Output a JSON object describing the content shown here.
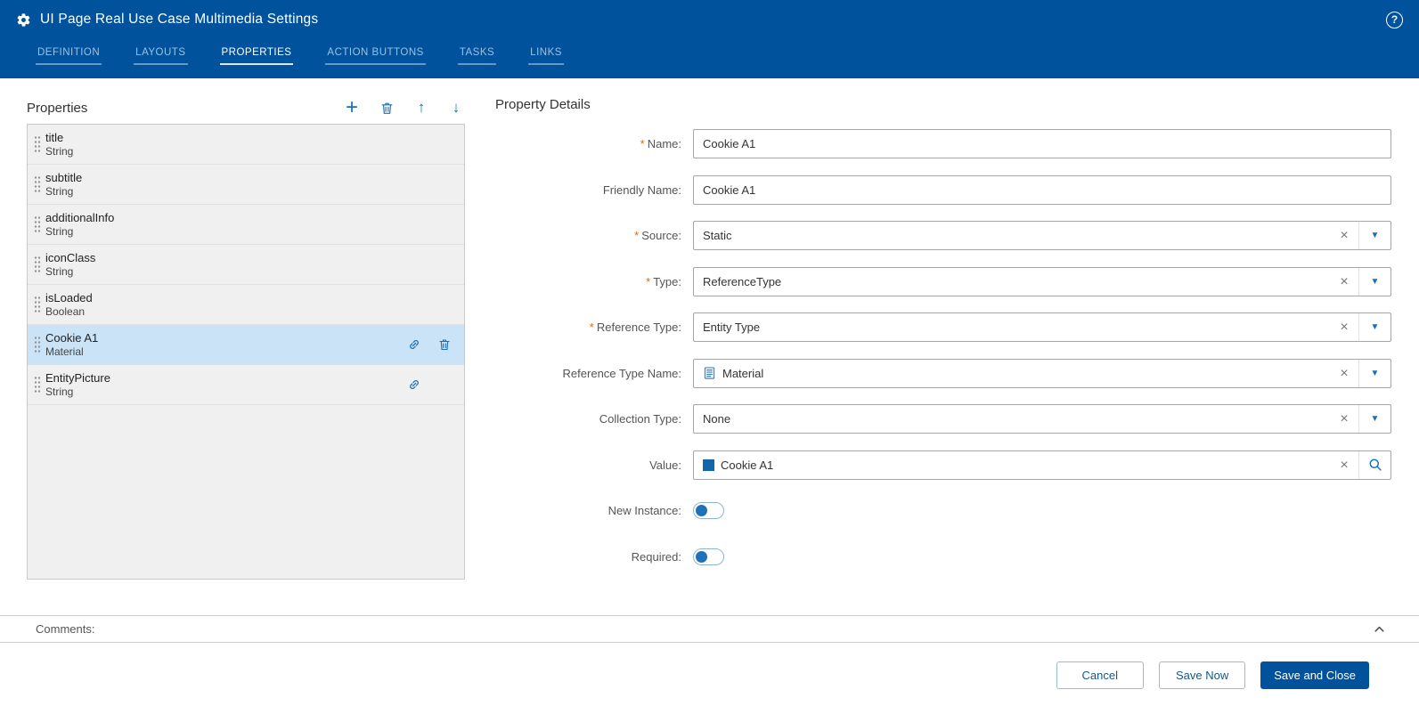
{
  "colors": {
    "header_bg": "#00529C",
    "accent_blue": "#1A6FB5",
    "primary_button_bg": "#00529C",
    "selected_row_bg": "#CBE3F6",
    "required_marker": "#E06A00"
  },
  "icons": {
    "help": "?",
    "plus": "+",
    "arrow_up": "↑",
    "arrow_down": "↓",
    "clear": "×",
    "caret": "▼"
  },
  "header": {
    "title": "UI Page Real Use Case Multimedia Settings"
  },
  "tabs": [
    {
      "label": "DEFINITION",
      "active": false
    },
    {
      "label": "LAYOUTS",
      "active": false
    },
    {
      "label": "PROPERTIES",
      "active": true
    },
    {
      "label": "ACTION BUTTONS",
      "active": false
    },
    {
      "label": "TASKS",
      "active": false
    },
    {
      "label": "LINKS",
      "active": false
    }
  ],
  "properties": {
    "title": "Properties",
    "items": [
      {
        "name": "title",
        "type": "String"
      },
      {
        "name": "subtitle",
        "type": "String"
      },
      {
        "name": "additionalInfo",
        "type": "String"
      },
      {
        "name": "iconClass",
        "type": "String"
      },
      {
        "name": "isLoaded",
        "type": "Boolean"
      },
      {
        "name": "Cookie A1",
        "type": "Material"
      },
      {
        "name": "EntityPicture",
        "type": "String"
      }
    ]
  },
  "details": {
    "title": "Property Details",
    "required_marker": "*",
    "fields": {
      "name": {
        "label": "Name:",
        "value": "Cookie A1"
      },
      "friendly_name": {
        "label": "Friendly Name:",
        "value": "Cookie A1"
      },
      "source": {
        "label": "Source:",
        "value": "Static"
      },
      "type": {
        "label": "Type:",
        "value": "ReferenceType"
      },
      "reference_type": {
        "label": "Reference Type:",
        "value": "Entity Type"
      },
      "reference_type_name": {
        "label": "Reference Type Name:",
        "value": "Material"
      },
      "collection_type": {
        "label": "Collection Type:",
        "value": "None"
      },
      "value": {
        "label": "Value:",
        "value": "Cookie A1"
      },
      "new_instance": {
        "label": "New Instance:",
        "state": "off"
      },
      "required": {
        "label": "Required:",
        "state": "off"
      }
    }
  },
  "comments": {
    "label": "Comments:"
  },
  "footer": {
    "cancel": "Cancel",
    "save_now": "Save Now",
    "save_and_close": "Save and Close"
  }
}
